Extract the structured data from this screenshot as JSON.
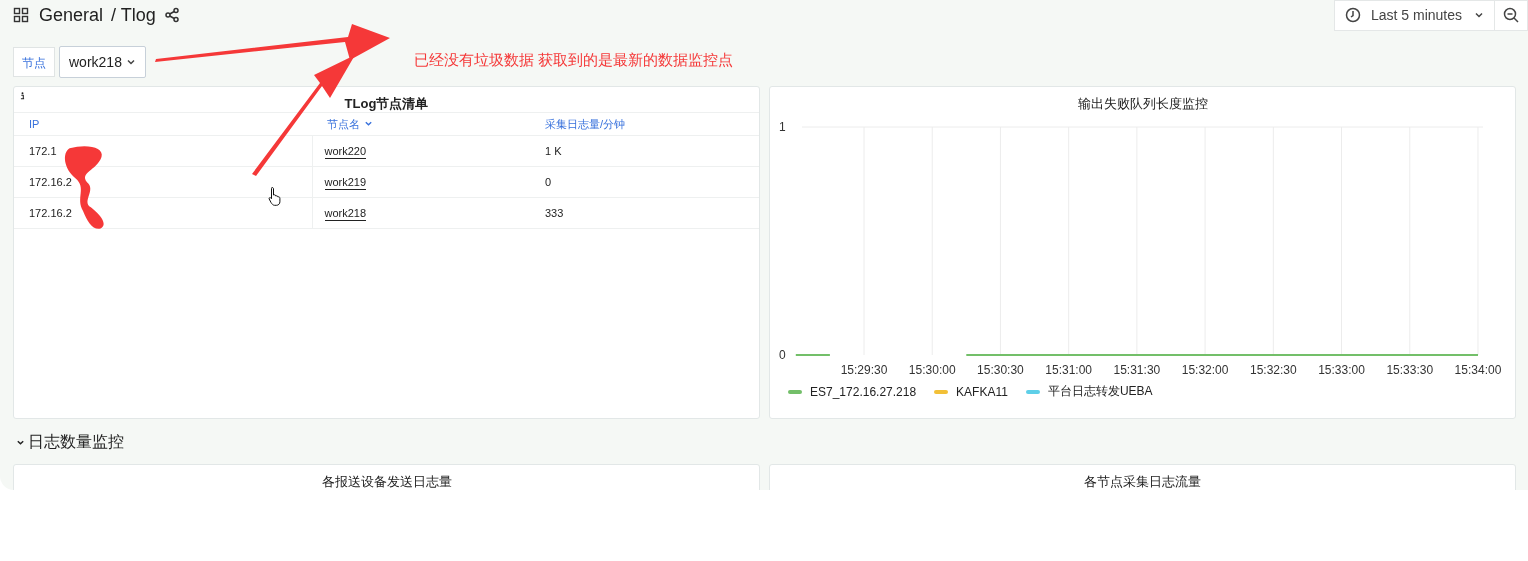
{
  "breadcrumb": {
    "folder": "General",
    "separator": "/ Tlog"
  },
  "time_picker": {
    "label": "Last 5 minutes"
  },
  "variable": {
    "label": "节点",
    "value": "work218"
  },
  "annotation": {
    "text": "已经没有垃圾数据 获取到的是最新的数据监控点"
  },
  "table_panel": {
    "title": "TLog节点清单",
    "columns": [
      "IP",
      "节点名",
      "采集日志量/分钟"
    ],
    "rows": [
      {
        "ip": "172.1",
        "node": "work220",
        "volume": "1 K"
      },
      {
        "ip": "172.16.2",
        "node": "work219",
        "volume": "0"
      },
      {
        "ip": "172.16.2",
        "node": "work218",
        "volume": "333"
      }
    ]
  },
  "chart_panel": {
    "title": "输出失败队列长度监控",
    "chart_data": {
      "type": "line",
      "grid": true,
      "ylim": [
        0,
        1
      ],
      "yticks": [
        0,
        1
      ],
      "categories": [
        null,
        null,
        "15:29:30",
        null,
        "15:30:00",
        null,
        "15:30:30",
        null,
        "15:31:00",
        null,
        "15:31:30",
        null,
        "15:32:00",
        null,
        "15:32:30",
        null,
        "15:33:00",
        null,
        "15:33:30",
        null,
        "15:34:00"
      ],
      "series": [
        {
          "name": "ES7_172.16.27.218",
          "color": "#73bf69",
          "values": [
            0,
            0,
            null,
            null,
            null,
            0,
            0,
            0,
            0,
            0,
            0,
            0,
            0,
            0,
            0,
            0,
            0,
            0,
            0,
            0,
            0
          ]
        },
        {
          "name": "KAFKA11",
          "color": "#f2c037",
          "values": [
            null,
            null,
            null,
            null,
            null,
            null,
            null,
            null,
            null,
            null,
            null,
            null,
            null,
            null,
            null,
            null,
            null,
            null,
            null,
            null,
            null
          ]
        },
        {
          "name": "平台日志转发UEBA",
          "color": "#5ecfe8",
          "values": [
            null,
            null,
            null,
            null,
            null,
            null,
            null,
            null,
            null,
            null,
            null,
            null,
            null,
            null,
            null,
            null,
            null,
            null,
            null,
            null,
            null
          ]
        }
      ]
    }
  },
  "row_section": {
    "title": "日志数量监控",
    "expanded": true
  },
  "bottom_panels": [
    {
      "title": "各报送设备发送日志量"
    },
    {
      "title": "各节点采集日志流量"
    }
  ]
}
